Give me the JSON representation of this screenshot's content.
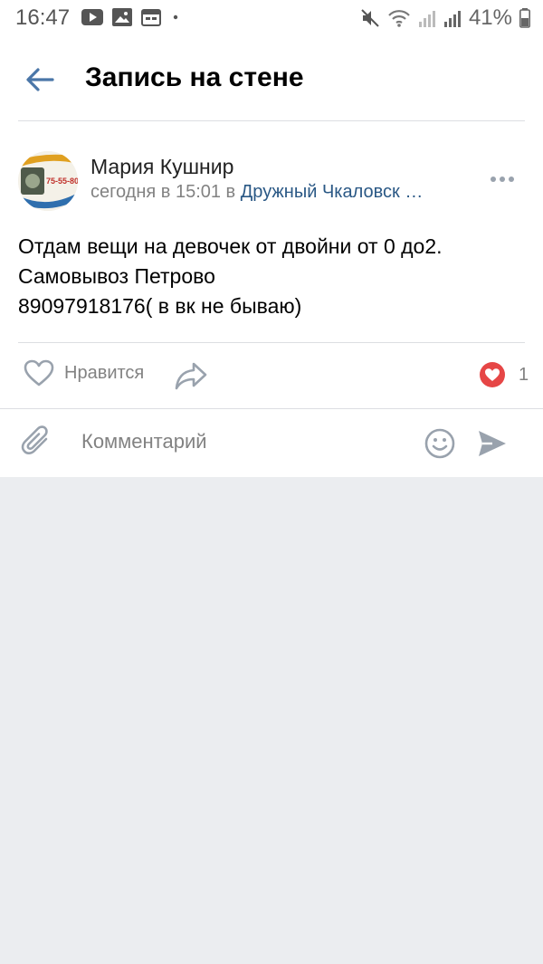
{
  "status_bar": {
    "time": "16:47",
    "battery": "41%",
    "left_icons": [
      "youtube-icon",
      "gallery-icon",
      "calendar-icon",
      "dot"
    ],
    "right_icons": [
      "mute-icon",
      "wifi-icon",
      "signal-icon",
      "signal-icon",
      "battery-icon"
    ]
  },
  "header": {
    "title": "Запись на стене",
    "back_icon": "arrow-left-icon"
  },
  "post": {
    "author": "Мария Кушнир",
    "time": "сегодня в 15:01 в",
    "group": "Дружный Чкаловск …",
    "avatar_text": "75-55-80",
    "text_lines": [
      "Отдам вещи на девочек от двойни от 0 до2.",
      "Самовывоз Петрово",
      "89097918176( в вк не бываю)"
    ],
    "like_label": "Нравится",
    "likes_count": "1"
  },
  "comment": {
    "placeholder": "Комментарий"
  },
  "colors": {
    "accent": "#4a76a8",
    "link": "#2a5885",
    "like_red": "#e64646",
    "icon_gray": "#99a2ad",
    "background": "#ebedf0"
  }
}
